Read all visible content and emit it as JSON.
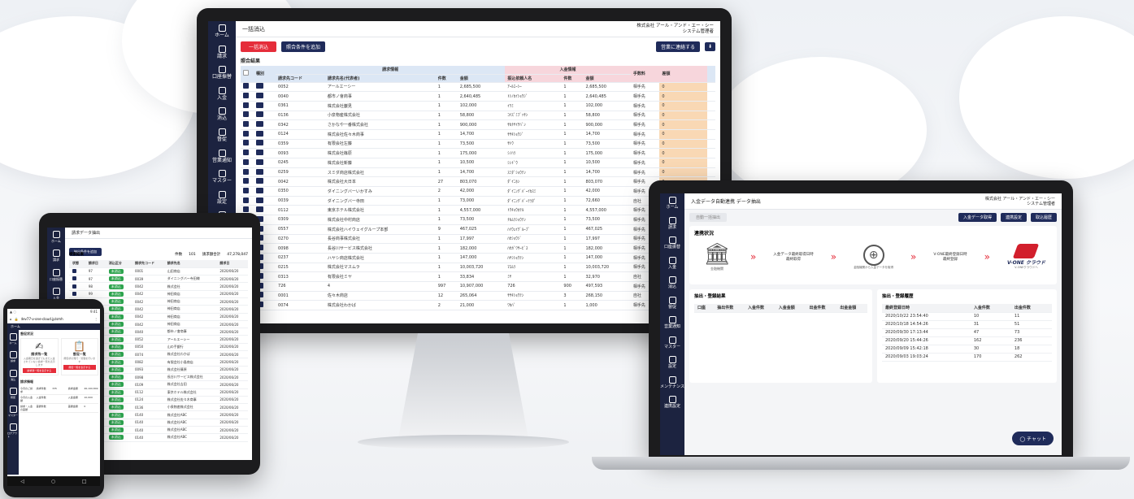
{
  "monitor": {
    "title": "一括消込",
    "company": "株式会社 アール・アンド・エー・シー",
    "user": "システム管理者",
    "btn_bulk": "一括消込",
    "btn_add_condition": "照合条件を追加",
    "btn_save": "営業に連絡する",
    "section": "照合結果",
    "group_claim": "請求情報",
    "group_deposit": "入金情報",
    "headers": [
      "種別",
      "請求先コード",
      "請求先名(代表者)",
      "件数",
      "金額",
      "振込依頼人名",
      "件数",
      "金額",
      "手数料",
      "差額",
      "",
      ""
    ],
    "sidebar": [
      {
        "label": "ホーム"
      },
      {
        "label": "請求"
      },
      {
        "label": "口座振替"
      },
      {
        "label": "入金"
      },
      {
        "label": "消込"
      },
      {
        "label": "督促"
      },
      {
        "label": "営業通知"
      },
      {
        "label": "マスター"
      },
      {
        "label": "設定"
      },
      {
        "label": "メンテナンス"
      }
    ],
    "rows": [
      {
        "code": "0052",
        "name": "アールエーシー",
        "cnt": "1",
        "amt": "2,685,500",
        "payer": "ｱｰﾙｴｰｼｰ",
        "pc": "1",
        "pamt": "2,685,500",
        "fee": "相手先",
        "diff": "0"
      },
      {
        "code": "0040",
        "name": "都市ノ會商事",
        "cnt": "1",
        "amt": "2,640,485",
        "payer": "ﾄｼﾉｶｲｼｮｳｼﾞ",
        "pc": "1",
        "pamt": "2,640,485",
        "fee": "相手先",
        "diff": "0"
      },
      {
        "code": "0361",
        "name": "株式会社巖見",
        "cnt": "1",
        "amt": "102,000",
        "payer": "ｲﾜﾐ",
        "pc": "1",
        "pamt": "102,000",
        "fee": "相手先",
        "diff": "0"
      },
      {
        "code": "0136",
        "name": "小泉物産株式会社",
        "cnt": "1",
        "amt": "58,800",
        "payer": "ｺｲｽﾞﾐﾌﾞｯｻﾝ",
        "pc": "1",
        "pamt": "58,800",
        "fee": "相手先",
        "diff": "0"
      },
      {
        "code": "0342",
        "name": "さかなや一番株式会社",
        "cnt": "1",
        "amt": "900,000",
        "payer": "ｻｶﾅﾔｲﾁﾊﾞﾝ",
        "pc": "1",
        "pamt": "900,000",
        "fee": "相手先",
        "diff": "0"
      },
      {
        "code": "0124",
        "name": "株式会社佐々木商事",
        "cnt": "1",
        "amt": "14,700",
        "payer": "ｻｻｷｼｮｳｼﾞ",
        "pc": "1",
        "pamt": "14,700",
        "fee": "相手先",
        "diff": "0"
      },
      {
        "code": "0359",
        "name": "有限会社左藤",
        "cnt": "1",
        "amt": "73,500",
        "payer": "ｻﾄｳ",
        "pc": "1",
        "pamt": "73,500",
        "fee": "相手先",
        "diff": "0"
      },
      {
        "code": "0093",
        "name": "株式会社篠原",
        "cnt": "1",
        "amt": "175,000",
        "payer": "ｼﾉﾊﾗ",
        "pc": "1",
        "pamt": "175,000",
        "fee": "相手先",
        "diff": "0"
      },
      {
        "code": "0245",
        "name": "株式会社新藤",
        "cnt": "1",
        "amt": "10,500",
        "payer": "ｼﾝﾄﾞｳ",
        "pc": "1",
        "pamt": "10,500",
        "fee": "相手先",
        "diff": "0"
      },
      {
        "code": "0259",
        "name": "スミダ商店株式会社",
        "cnt": "1",
        "amt": "14,700",
        "payer": "ｽﾐﾀﾞｼｮｳﾃﾝ",
        "pc": "1",
        "pamt": "14,700",
        "fee": "相手先",
        "diff": "0"
      },
      {
        "code": "0042",
        "name": "株式会社大日本",
        "cnt": "27",
        "amt": "803,070",
        "payer": "ﾀﾞｲﾆﾎﾝ",
        "pc": "1",
        "pamt": "803,070",
        "fee": "相手先",
        "diff": "0"
      },
      {
        "code": "0350",
        "name": "ダイニングバーいかすみ",
        "cnt": "2",
        "amt": "42,000",
        "payer": "ﾀﾞｲﾆﾝｸﾞﾊﾞｰｲｶｽﾐ",
        "pc": "1",
        "pamt": "42,000",
        "fee": "相手先",
        "diff": "0"
      },
      {
        "code": "0039",
        "name": "ダイニングバー寺田",
        "cnt": "1",
        "amt": "73,000",
        "payer": "ﾀﾞｲﾆﾝｸﾞﾊﾞｰﾃﾗﾀﾞ",
        "pc": "1",
        "pamt": "72,660",
        "fee": "自社",
        "diff": "340"
      },
      {
        "code": "0112",
        "name": "東京ホテル株式会社",
        "cnt": "1",
        "amt": "4,557,000",
        "payer": "ﾄｳｷｮｳﾎﾃﾙ",
        "pc": "1",
        "pamt": "4,557,000",
        "fee": "相手先",
        "diff": "0"
      },
      {
        "code": "0309",
        "name": "株式会社中村商店",
        "cnt": "1",
        "amt": "73,500",
        "payer": "ﾅｶﾑﾗｼｮｳﾃﾝ",
        "pc": "1",
        "pamt": "73,500",
        "fee": "相手先",
        "diff": "0"
      },
      {
        "code": "0557",
        "name": "株式会社ハイウェイグループ本部",
        "cnt": "9",
        "amt": "467,025",
        "payer": "ﾊｲｳｪｲｸﾞﾙｰﾌﾟ",
        "pc": "1",
        "pamt": "467,025",
        "fee": "相手先",
        "diff": "0"
      },
      {
        "code": "0270",
        "name": "長谷商事株式会社",
        "cnt": "1",
        "amt": "17,997",
        "payer": "ﾊｾｼｮｳｼﾞ",
        "pc": "1",
        "pamt": "17,997",
        "fee": "相手先",
        "diff": "0"
      },
      {
        "code": "0098",
        "name": "長谷川サービス株式会社",
        "cnt": "1",
        "amt": "182,000",
        "payer": "ﾊｾｶﾞﾜｻｰﾋﾞｽ",
        "pc": "1",
        "pamt": "182,000",
        "fee": "相手先",
        "diff": "0"
      },
      {
        "code": "0237",
        "name": "ハヤシ商店株式会社",
        "cnt": "1",
        "amt": "147,000",
        "payer": "ﾊﾔｼｼｮｳﾃﾝ",
        "pc": "1",
        "pamt": "147,000",
        "fee": "相手先",
        "diff": "0"
      },
      {
        "code": "0215",
        "name": "株式会社マスムラ",
        "cnt": "1",
        "amt": "10,003,720",
        "payer": "ﾏｽﾑﾗ",
        "pc": "1",
        "pamt": "10,003,720",
        "fee": "相手先",
        "diff": "0"
      },
      {
        "code": "0313",
        "name": "有限会社ミヤ",
        "cnt": "1",
        "amt": "33,834",
        "payer": "ﾐﾔ",
        "pc": "1",
        "pamt": "32,970",
        "fee": "自社",
        "diff": "864"
      },
      {
        "code": "726",
        "name": "4",
        "cnt": "997",
        "amt": "10,907,000",
        "payer": "726",
        "pc": "900",
        "pamt": "497,593",
        "fee": "相手先",
        "diff": "10,409,407"
      },
      {
        "code": "0001",
        "name": "佐々木商店",
        "cnt": "12",
        "amt": "265,064",
        "payer": "ｻｻｷｼｮｳﾃﾝ",
        "pc": "3",
        "pamt": "268,150",
        "fee": "自社",
        "diff": "-301,686"
      },
      {
        "code": "0074",
        "name": "株式会社わかば",
        "cnt": "2",
        "amt": "21,000",
        "payer": "ﾜｶﾊﾞ",
        "pc": "1",
        "pamt": "1,000",
        "fee": "相手先",
        "diff": "20,000"
      }
    ]
  },
  "laptop": {
    "title": "入金データ自動連携 データ抽出",
    "company": "株式会社 アール・アンド・エー・シー",
    "user": "システム管理者",
    "chip": "自動一括抽出",
    "btn1": "入金データ取得",
    "btn2": "連携設定",
    "btn3": "取込履歴",
    "section1": "連携状況",
    "flow": [
      "",
      "入金データ最終取得日時\n最終取得",
      "",
      "V-ONE最終登録日時\n最終登録",
      ""
    ],
    "flow_cap": [
      "金融機関",
      "",
      "金融機関から入金データを取得",
      "",
      "V-ONEクラウドへ"
    ],
    "brand": "V-ONE クラウド",
    "section2": "抽出・登録結果",
    "res_headers": [
      "口座",
      "抽出件数",
      "入金件数",
      "入金金額",
      "出金件数",
      "出金金額"
    ],
    "section3": "抽出・登録履歴",
    "hist_headers": [
      "最終登録日時",
      "入金件数",
      "出金件数"
    ],
    "hist": [
      [
        "2020/10/22 23:54:40",
        "10",
        "11"
      ],
      [
        "2020/10/18 14:54:26",
        "31",
        "51"
      ],
      [
        "2020/09/30 17:13:44",
        "47",
        "73"
      ],
      [
        "2020/09/20 15:44:26",
        "162",
        "236"
      ],
      [
        "2020/09/09 15:42:18",
        "30",
        "18"
      ],
      [
        "2020/09/03 19:03:24",
        "170",
        "262"
      ]
    ],
    "chat": "チャット",
    "sidebar": [
      {
        "label": "ホーム"
      },
      {
        "label": "請求"
      },
      {
        "label": "口座振替"
      },
      {
        "label": "入金"
      },
      {
        "label": "消込"
      },
      {
        "label": "督促"
      },
      {
        "label": "営業通知"
      },
      {
        "label": "マスター"
      },
      {
        "label": "設定"
      },
      {
        "label": "メンテナンス"
      },
      {
        "label": "連携設定"
      }
    ]
  },
  "tablet": {
    "title": "請求データ抽出",
    "btn": "抽出条件を追加",
    "section": "検索結果",
    "count_label": "件数",
    "count": "101",
    "total_label": "請求額合計",
    "total": "47,278,047",
    "headers": [
      "状態",
      "請求日",
      "消込区分",
      "請求先コード",
      "請求先名",
      "請求日"
    ],
    "rows": [
      [
        "97",
        "未消込",
        "0001",
        "山田商店",
        "2020/06/20"
      ],
      [
        "97",
        "未消込",
        "0039",
        "ダイニングバー寺田様",
        "2020/06/20"
      ],
      [
        "98",
        "未消込",
        "0042",
        "株式会社",
        "2020/06/20"
      ],
      [
        "99",
        "未消込",
        "0042",
        "神田商店",
        "2020/06/20"
      ],
      [
        "100",
        "未消込",
        "0042",
        "神田商店",
        "2020/06/20"
      ],
      [
        "101",
        "未消込",
        "0042",
        "神田商店",
        "2020/06/20"
      ],
      [
        "102",
        "未消込",
        "0042",
        "神田商店",
        "2020/06/20"
      ],
      [
        "103",
        "未消込",
        "0042",
        "神田商店",
        "2020/06/20"
      ],
      [
        "104",
        "未消込",
        "0040",
        "都市ノ會商事",
        "2020/06/20"
      ],
      [
        "105",
        "未消込",
        "0052",
        "アールエーシー",
        "2020/06/20"
      ],
      [
        "107",
        "未消込",
        "0050",
        "山の手銀行",
        "2020/06/20"
      ],
      [
        "108",
        "未消込",
        "0074",
        "株式会社わかば",
        "2020/06/20"
      ],
      [
        "110",
        "未消込",
        "0082",
        "有限会社小島商店",
        "2020/06/20"
      ],
      [
        "111",
        "未消込",
        "0093",
        "株式会社篠原",
        "2020/06/20"
      ],
      [
        "112",
        "未消込",
        "0098",
        "長谷川サービス株式会社",
        "2020/06/20"
      ],
      [
        "113",
        "未消込",
        "0109",
        "株式会社吉田",
        "2020/06/20"
      ],
      [
        "114",
        "未消込",
        "0112",
        "東京ホテル株式会社",
        "2020/06/20"
      ],
      [
        "116",
        "未消込",
        "0124",
        "株式会社佐々木商事",
        "2020/06/20"
      ],
      [
        "117",
        "未消込",
        "0136",
        "小泉物産株式会社",
        "2020/06/20"
      ],
      [
        "118",
        "未消込",
        "0140",
        "株式会社ABC",
        "2020/06/20"
      ],
      [
        "119",
        "未消込",
        "0140",
        "株式会社ABC",
        "2020/06/20"
      ],
      [
        "120",
        "未消込",
        "0140",
        "株式会社ABC",
        "2020/06/20"
      ],
      [
        "121",
        "未消込",
        "0140",
        "株式会社ABC",
        "2020/06/20"
      ]
    ],
    "sidebar": [
      {
        "label": "ホーム"
      },
      {
        "label": "請求"
      },
      {
        "label": "口座振替"
      },
      {
        "label": "入金"
      },
      {
        "label": "消込"
      }
    ]
  },
  "phone": {
    "status_time": "9:41",
    "url": "dev77-v-one-cloud.jp/smh",
    "nav": "ホーム",
    "section": "督促状況",
    "card1_title": "請求残一覧",
    "card1_text": "入金期日を過ぎてもまだ入金されていない請求一覧を表示します",
    "card1_btn": "請求残一覧を表示する",
    "card2_title": "督促一覧",
    "card2_text": "督促状の発行・管理を行います",
    "card2_btn": "督促一覧を表示する",
    "section2": "請求情報",
    "rows": [
      [
        "今月のご請求",
        "請求件数",
        "335",
        "請求金額",
        "46,190,849"
      ],
      [
        "今月の入金額",
        "入金件数",
        "",
        "入金金額",
        "10,000"
      ],
      [
        "請求・入金の差額",
        "差額件数",
        "",
        "差額金額",
        "0"
      ]
    ],
    "sidebar": [
      {
        "label": "ホーム"
      },
      {
        "label": "請求"
      },
      {
        "label": "消込"
      },
      {
        "label": "督促"
      },
      {
        "label": "マスター"
      },
      {
        "label": "ログアウト"
      }
    ]
  }
}
